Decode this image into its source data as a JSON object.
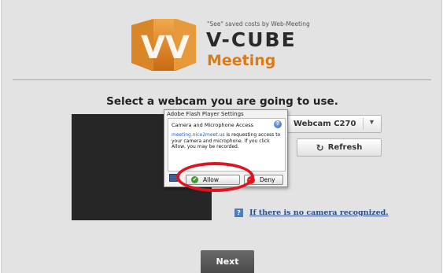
{
  "header": {
    "tagline": "\"See\" saved costs by Web-Meeting",
    "brand": "V-CUBE",
    "product": "Meeting",
    "logo_icon": "vv-logo-icon",
    "product_color": "#d87b18"
  },
  "main": {
    "heading": "Select a webcam you are going to use.",
    "camera_select": {
      "value": "Webcam C270",
      "icon": "chevron-down-icon"
    },
    "refresh_button": {
      "label": "Refresh",
      "icon": "refresh-icon"
    },
    "help_link": {
      "text": "If there is no camera recognized.",
      "icon": "help-icon",
      "icon_glyph": "?"
    },
    "next_button": {
      "label": "Next"
    }
  },
  "flash_dialog": {
    "title": "Adobe Flash Player Settings",
    "heading": "Camera and Microphone Access",
    "help_glyph": "?",
    "domain": "meeting.nice2meet.us",
    "message_rest": " is requesting access to your camera and microphone. If you click Allow, you may be recorded.",
    "allow_label": "Allow",
    "deny_label": "Deny"
  },
  "colors": {
    "annotation_ring": "#e0141e",
    "link": "#2a4d8a"
  }
}
